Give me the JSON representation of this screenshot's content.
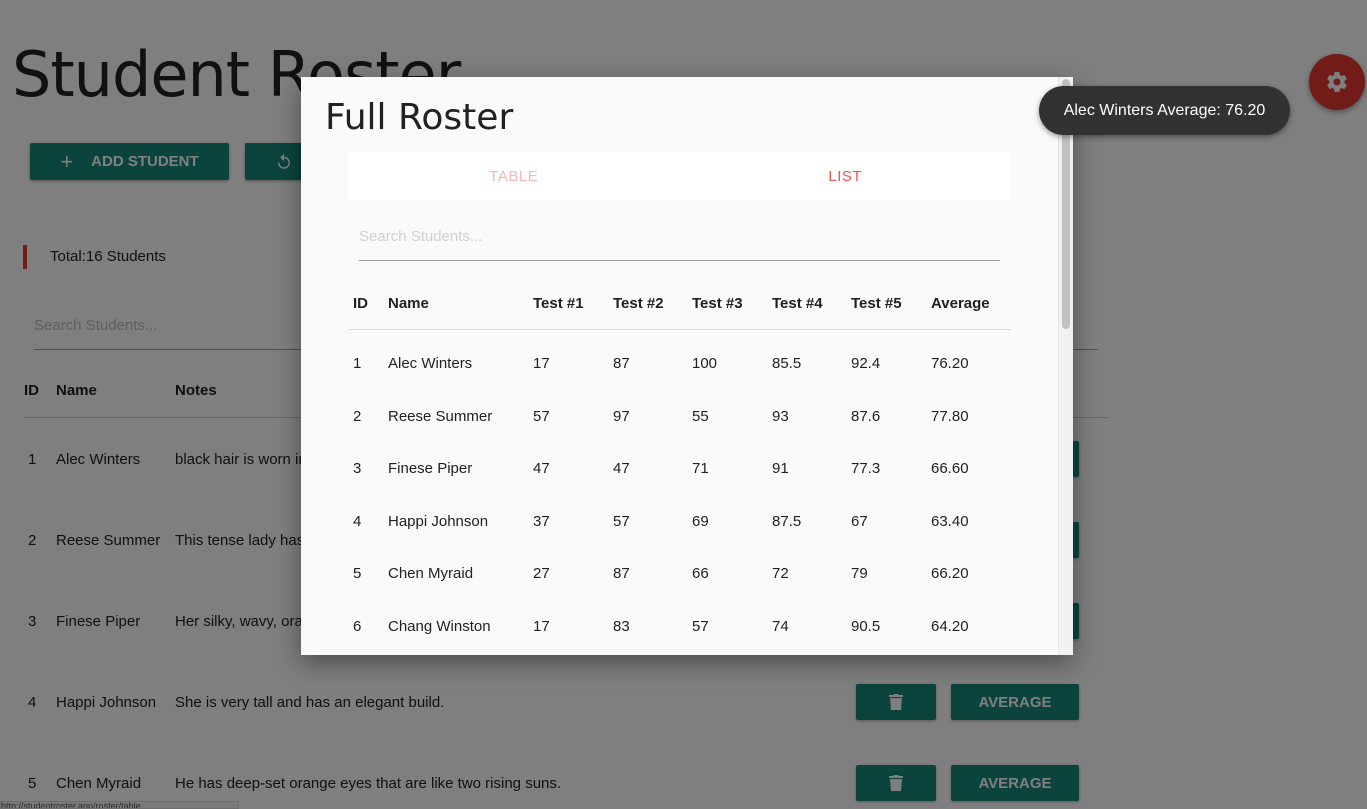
{
  "page": {
    "title": "Student Roster",
    "add_label": "ADD STUDENT",
    "total": "Total:16 Students",
    "search_placeholder": "Search Students...",
    "status_url": "http://studentroster.app/roster/table"
  },
  "table": {
    "columns": [
      "ID",
      "Name",
      "Notes"
    ],
    "rows": [
      {
        "id": "1",
        "name": "Alec Winters",
        "notes": "black hair is worn in"
      },
      {
        "id": "2",
        "name": "Reese Summer",
        "notes": "This tense lady has"
      },
      {
        "id": "3",
        "name": "Finese Piper",
        "notes": "Her silky, wavy, ora"
      },
      {
        "id": "4",
        "name": "Happi Johnson",
        "notes": "She is very tall and has an elegant build."
      },
      {
        "id": "5",
        "name": "Chen Myraid",
        "notes": "He has deep-set orange eyes that are like two rising suns."
      }
    ],
    "average_label": "AVERAGE"
  },
  "modal": {
    "title": "Full Roster",
    "tabs": [
      "TABLE",
      "LIST"
    ],
    "search_placeholder": "Search Students...",
    "columns": [
      "ID",
      "Name",
      "Test #1",
      "Test #2",
      "Test #3",
      "Test #4",
      "Test #5",
      "Average"
    ],
    "rows": [
      [
        "1",
        "Alec Winters",
        "17",
        "87",
        "100",
        "85.5",
        "92.4",
        "76.20"
      ],
      [
        "2",
        "Reese Summer",
        "57",
        "97",
        "55",
        "93",
        "87.6",
        "77.80"
      ],
      [
        "3",
        "Finese Piper",
        "47",
        "47",
        "71",
        "91",
        "77.3",
        "66.60"
      ],
      [
        "4",
        "Happi Johnson",
        "37",
        "57",
        "69",
        "87.5",
        "67",
        "63.40"
      ],
      [
        "5",
        "Chen Myraid",
        "27",
        "87",
        "66",
        "72",
        "79",
        "66.20"
      ],
      [
        "6",
        "Chang Winston",
        "17",
        "83",
        "57",
        "74",
        "90.5",
        "64.20"
      ]
    ]
  },
  "tooltip": "Alec Winters Average: 76.20",
  "icons": {
    "add": "plus-icon",
    "reset": "reset-icon",
    "settings": "gear-icon",
    "delete": "trash-icon"
  },
  "colors": {
    "accent": "#e53935",
    "primary": "#16897a",
    "tab_active": "#ef5350",
    "tab_inactive": "#f4b6b4"
  }
}
